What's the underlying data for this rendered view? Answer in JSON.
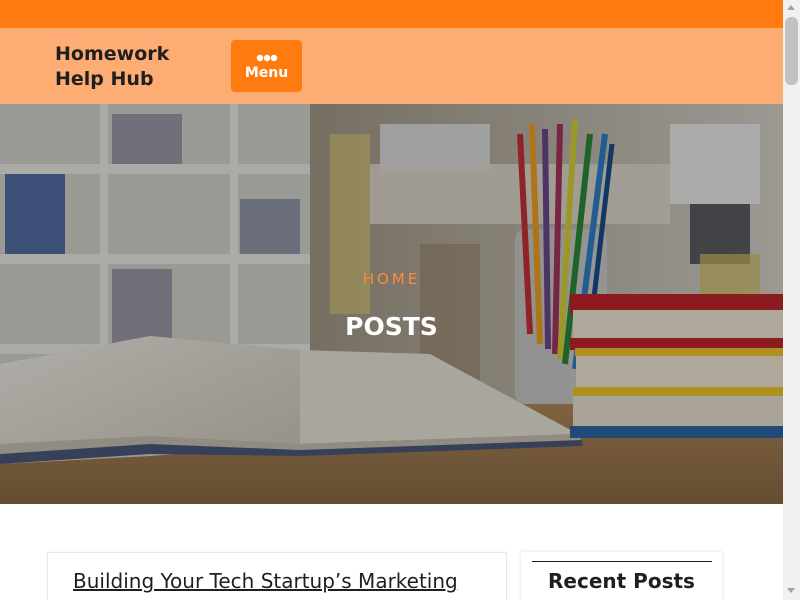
{
  "site": {
    "title": "Homework\nHelp Hub",
    "menu_label": "Menu",
    "menu_icon": "dots-horizontal-icon"
  },
  "colors": {
    "accent": "#ff7a0f",
    "header_bg": "#fdac73",
    "breadcrumb": "#ff8b3d",
    "text": "#1f1f1f"
  },
  "hero": {
    "breadcrumb_home": "HOME",
    "page_title": "POSTS",
    "image": "library-desk-books-pencils-photo"
  },
  "main": {
    "post_title": "Building Your Tech Startup’s Marketing Vendor Brand Consultants and"
  },
  "sidebar": {
    "widget_title": "Recent Posts"
  }
}
